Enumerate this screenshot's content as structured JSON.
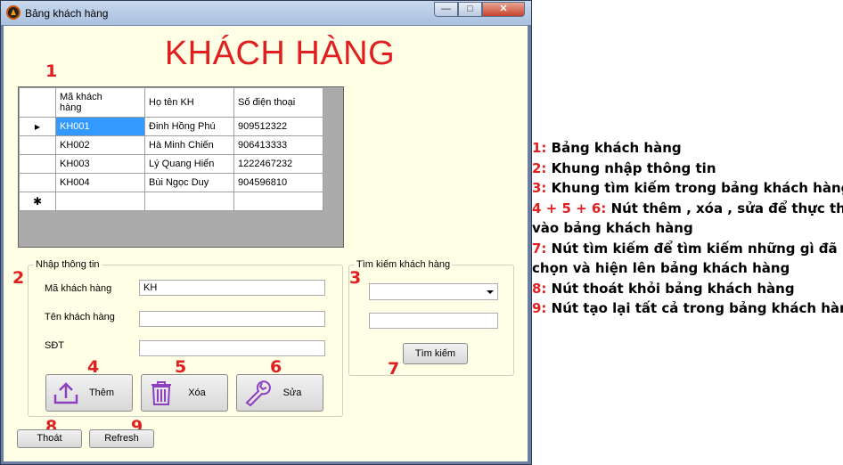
{
  "window": {
    "title": "Bảng khách hàng",
    "min_glyph": "—",
    "max_glyph": "□",
    "close_glyph": "✕"
  },
  "form_title": "KHÁCH HÀNG",
  "grid": {
    "columns": [
      "Mã khách hàng",
      "Họ tên KH",
      "Số điện thoại"
    ],
    "rows": [
      [
        "KH001",
        "Đinh Hồng Phú",
        "909512322"
      ],
      [
        "KH002",
        "Hà Minh Chiến",
        "906413333"
      ],
      [
        "KH003",
        "Lý Quang Hiển",
        "1222467232"
      ],
      [
        "KH004",
        "Bùi Ngọc Duy",
        "904596810"
      ]
    ],
    "current_row_glyph": "▶",
    "new_row_glyph": "✱"
  },
  "input_group": {
    "title": "Nhập thông tin",
    "fields": [
      {
        "label": "Mã khách hàng",
        "value": "KH"
      },
      {
        "label": "Tên khách hàng",
        "value": ""
      },
      {
        "label": "SĐT",
        "value": ""
      }
    ],
    "buttons": [
      {
        "label": "Thêm",
        "icon": "upload-icon"
      },
      {
        "label": "Xóa",
        "icon": "trash-icon"
      },
      {
        "label": "Sửa",
        "icon": "wrench-icon"
      }
    ]
  },
  "search_group": {
    "title": "Tìm kiếm khách hàng",
    "combo_value": "",
    "text_value": "",
    "button_label": "Tìm kiếm"
  },
  "bottom_buttons": {
    "exit_label": "Thoát",
    "refresh_label": "Refresh"
  },
  "annotations": [
    "1",
    "2",
    "3",
    "4",
    "5",
    "6",
    "7",
    "8",
    "9"
  ],
  "legend": [
    {
      "num": "1:",
      "text": " Bảng khách hàng"
    },
    {
      "num": "2:",
      "text": " Khung nhập thông tin"
    },
    {
      "num": "3:",
      "text": " Khung tìm kiếm trong bảng khách hàng"
    },
    {
      "num": "4 + 5 + 6:",
      "text": " Nút thêm , xóa , sửa để thực thi"
    },
    {
      "num": "",
      "text": "vào bảng khách hàng"
    },
    {
      "num": "7:",
      "text": " Nút tìm kiếm để tìm kiếm những gì đã"
    },
    {
      "num": "",
      "text": "chọn và hiện lên bảng khách hàng"
    },
    {
      "num": "8:",
      "text": " Nút thoát khỏi bảng khách hàng"
    },
    {
      "num": "9:",
      "text": " Nút tạo lại tất cả trong bảng khách hàng"
    }
  ],
  "colors": {
    "annotation_red": "#e02020",
    "form_background": "#ffffe6",
    "selection_blue": "#3399ff",
    "icon_purple": "#8e3fbf"
  }
}
